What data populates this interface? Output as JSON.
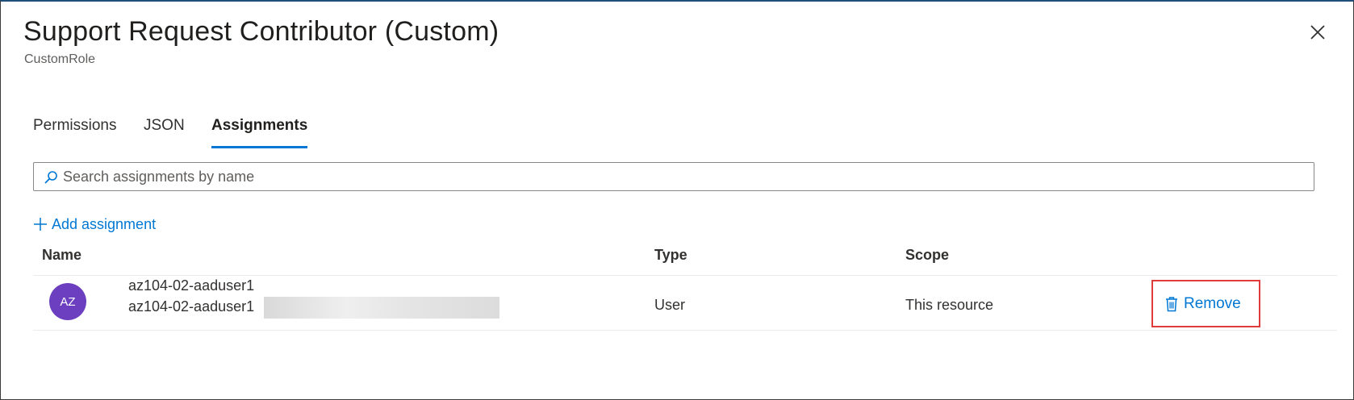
{
  "header": {
    "title": "Support Request Contributor (Custom)",
    "subtitle": "CustomRole",
    "close_icon": "close-icon"
  },
  "tabs": [
    {
      "label": "Permissions",
      "active": false
    },
    {
      "label": "JSON",
      "active": false
    },
    {
      "label": "Assignments",
      "active": true
    }
  ],
  "search": {
    "placeholder": "Search assignments by name",
    "value": "",
    "icon": "search-icon"
  },
  "toolbar": {
    "add_label": "Add assignment",
    "add_icon": "plus-icon"
  },
  "table": {
    "columns": [
      "Name",
      "Type",
      "Scope"
    ],
    "rows": [
      {
        "avatar_initials": "AZ",
        "avatar_color": "#6b3fbf",
        "name": "az104-02-aaduser1",
        "principal": "az104-02-aaduser1",
        "type": "User",
        "scope": "This resource",
        "action_label": "Remove",
        "action_icon": "trash-icon"
      }
    ]
  },
  "colors": {
    "accent": "#0078d4",
    "highlight_box": "#e03c3c"
  }
}
